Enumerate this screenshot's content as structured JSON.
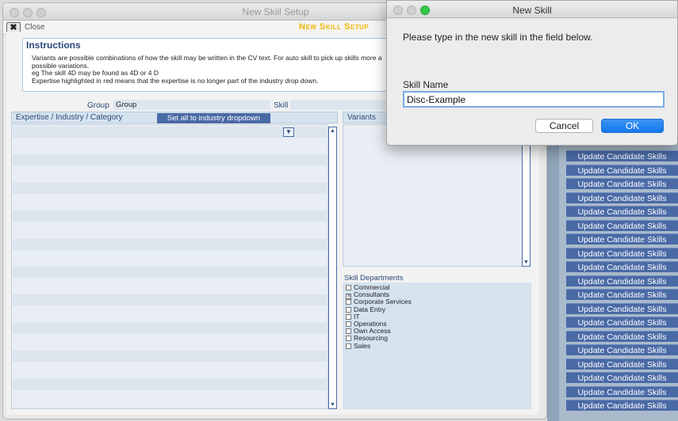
{
  "background_app": {
    "update_button_label": "Update Candidate Skills",
    "update_button_count": 19
  },
  "main_window": {
    "title": "New Skill Setup",
    "close_label": "Close",
    "setup_title": "New Skill Setup",
    "instructions": {
      "title": "Instructions",
      "lines": [
        "Variants are possible combinations of how the skill may be written in the CV text. For auto skill to pick up skills more a",
        "possible variations.",
        "eg The skill 4D may be found as 4D or 4 D",
        "Expertise highlighted in red means that the expertise is no longer part of the industry drop down."
      ]
    },
    "group_label": "Group",
    "group_value": "Group",
    "skill_label": "Skill",
    "expertise_header": "Expertise / Industry / Category",
    "set_all_button": "Set all to industry dropdown",
    "variants_header": "Variants",
    "departments_label": "Skill Departments",
    "departments": [
      {
        "name": "Commercial",
        "checked": false
      },
      {
        "name": "Consultants",
        "checked": true
      },
      {
        "name": "Corporate Services",
        "checked": false
      },
      {
        "name": "Data Entry",
        "checked": false
      },
      {
        "name": "IT",
        "checked": false
      },
      {
        "name": "Operations",
        "checked": false
      },
      {
        "name": "Own Access",
        "checked": false
      },
      {
        "name": "Resourcing",
        "checked": false
      },
      {
        "name": "Sales",
        "checked": false
      }
    ]
  },
  "dialog": {
    "title": "New Skill",
    "message": "Please type in the new skill in the field below.",
    "field_label": "Skill Name",
    "field_value": "Disc-Example",
    "cancel_label": "Cancel",
    "ok_label": "OK"
  },
  "colors": {
    "accent_blue": "#4a6aa6",
    "title_gold": "#f0b800",
    "ok_blue": "#1478ea"
  }
}
